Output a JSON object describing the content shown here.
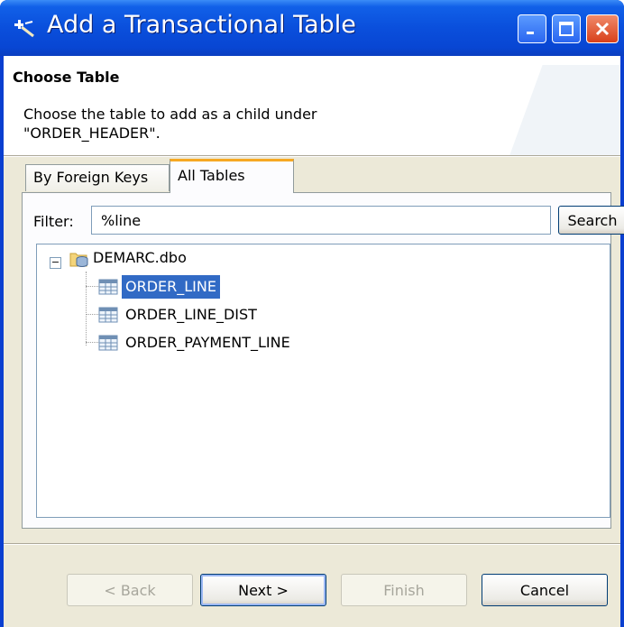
{
  "window": {
    "title": "Add a Transactional Table",
    "controls": {
      "minimize": "minimize",
      "maximize": "maximize",
      "close": "close"
    }
  },
  "header": {
    "title": "Choose Table",
    "description": "Choose the table to add as a child under \"ORDER_HEADER\"."
  },
  "tabs": [
    {
      "label": "By Foreign Keys",
      "selected": false
    },
    {
      "label": "All Tables",
      "selected": true
    }
  ],
  "filter": {
    "label": "Filter:",
    "value": "%line",
    "search_label": "Search"
  },
  "tree": {
    "root": {
      "label": "DEMARC.dbo",
      "expanded": true,
      "icon": "database-folder-icon"
    },
    "children": [
      {
        "label": "ORDER_LINE",
        "selected": true,
        "icon": "table-icon"
      },
      {
        "label": "ORDER_LINE_DIST",
        "selected": false,
        "icon": "table-icon"
      },
      {
        "label": "ORDER_PAYMENT_LINE",
        "selected": false,
        "icon": "table-icon"
      }
    ]
  },
  "buttons": {
    "back": "< Back",
    "next": "Next >",
    "finish": "Finish",
    "cancel": "Cancel"
  },
  "colors": {
    "titlebar": "#0a4fdc",
    "selection": "#316ac5",
    "tab_highlight": "#f6a823",
    "dialog_bg": "#ece9d8"
  }
}
